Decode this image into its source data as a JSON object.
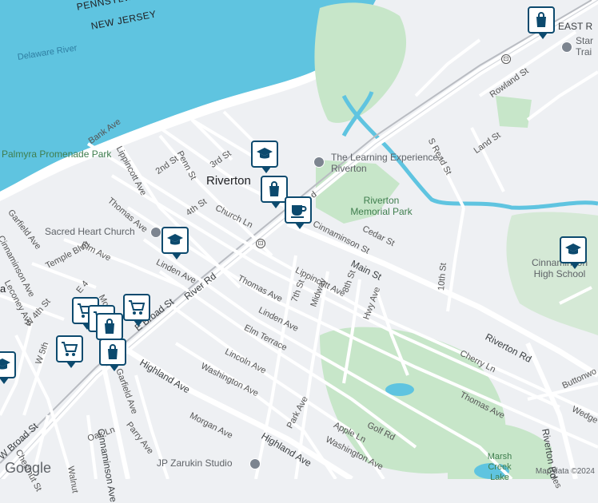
{
  "colors": {
    "water": "#5fc4e0",
    "park": "#c7e6c9",
    "land": "#eef0f3",
    "road": "#ffffff",
    "marker_border": "#0c4a6e"
  },
  "labels": {
    "state_pa": "PENNSYLVANIA",
    "state_nj": "NEW JERSEY",
    "delaware_river": "Delaware River",
    "palmyra_park": "Palmyra Promenade Park",
    "riverton": "Riverton",
    "learning_experience": "The Learning Experience - Riverton",
    "riverton_memorial_park": "Riverton Memorial Park",
    "sacred_heart": "Sacred Heart Church",
    "cinnaminson_hs": "Cinnaminson High School",
    "jp_zarukin": "JP Zarukin Studio",
    "marsh_creek_lake": "Marsh Creek Lake",
    "east_r": "EAST R",
    "star_trai": "Star Trai",
    "main_st": "Main St",
    "riverton_rd": "Riverton Rd",
    "river_rd": "River Rd",
    "e_broad_st": "E Broad St",
    "w_broad_st": "W Broad St",
    "highland_ave_1": "Highland Ave",
    "highland_ave_2": "Highland Ave",
    "cinnaminson_ave": "Cinnaminson Ave",
    "cinnaminson_st": "Cinnaminson St",
    "cedar_st": "Cedar St",
    "thomas_ave_1": "Thomas Ave",
    "thomas_ave_2": "Thomas Ave",
    "thomas_ave_3": "Thomas Ave",
    "linden_ave_1": "Linden Ave",
    "linden_ave_2": "Linden Ave",
    "elm_terrace": "Elm Terrace",
    "elm_ave": "Elm Ave",
    "lincoln_ave": "Lincoln Ave",
    "washington_ave_1": "Washington Ave",
    "washington_ave_2": "Washington Ave",
    "morgan_ave": "Morgan Ave",
    "park_ave": "Park Ave",
    "apple_ln": "Apple Ln",
    "golf_rd": "Golf Rd",
    "cherry_ln": "Cherry Ln",
    "lippincott_ave_1": "Lippincott Ave",
    "lippincott_ave_2": "Lippincott Ave",
    "midway": "Midway",
    "hwy_ave": "Hwy Ave",
    "st_7th": "7th St",
    "st_8th": "8th St",
    "st_10th": "10th St",
    "st_2nd": "2nd St",
    "st_3rd": "3rd St",
    "st_4th": "4th St",
    "penn_st": "Penn St",
    "bank_ave": "Bank Ave",
    "church_ln": "Church Ln",
    "garfield_ave_1": "Garfield Ave",
    "garfield_ave_2": "Garfield Ave",
    "temple_blvd": "Temple Blvd",
    "leconey_ave": "Leconey Ave",
    "cinnaminson_ave_w": "Cinnaminson Ave",
    "w_4th_st": "W 4th St",
    "w_5th": "W 5th",
    "mo": "Mo",
    "e_4": "E 4",
    "parry_ave": "Parry Ave",
    "oak_ln": "Oak Ln",
    "walnut": "Walnut",
    "chestnut_st": "Chestnut St",
    "s_read_st": "S Read St",
    "land_st": "Land St",
    "rowland_st": "Rowland St",
    "buttonwood": "Buttonwo",
    "wedge": "Wedge",
    "coles": "Coles",
    "a_edge": "a"
  },
  "attribution": "Map data ©2024",
  "logo": "Google",
  "markers": [
    {
      "type": "shopping",
      "icon": "shopping-bag-icon"
    },
    {
      "type": "school",
      "icon": "graduation-cap-icon"
    },
    {
      "type": "shopping",
      "icon": "shopping-bag-icon"
    },
    {
      "type": "cafe",
      "icon": "coffee-cup-icon"
    },
    {
      "type": "school",
      "icon": "graduation-cap-icon"
    },
    {
      "type": "school",
      "icon": "graduation-cap-icon"
    },
    {
      "type": "shopping",
      "icon": "shopping-cart-icon"
    },
    {
      "type": "shopping",
      "icon": "shopping-bag-icon"
    },
    {
      "type": "school",
      "icon": "graduation-cap-icon"
    }
  ]
}
